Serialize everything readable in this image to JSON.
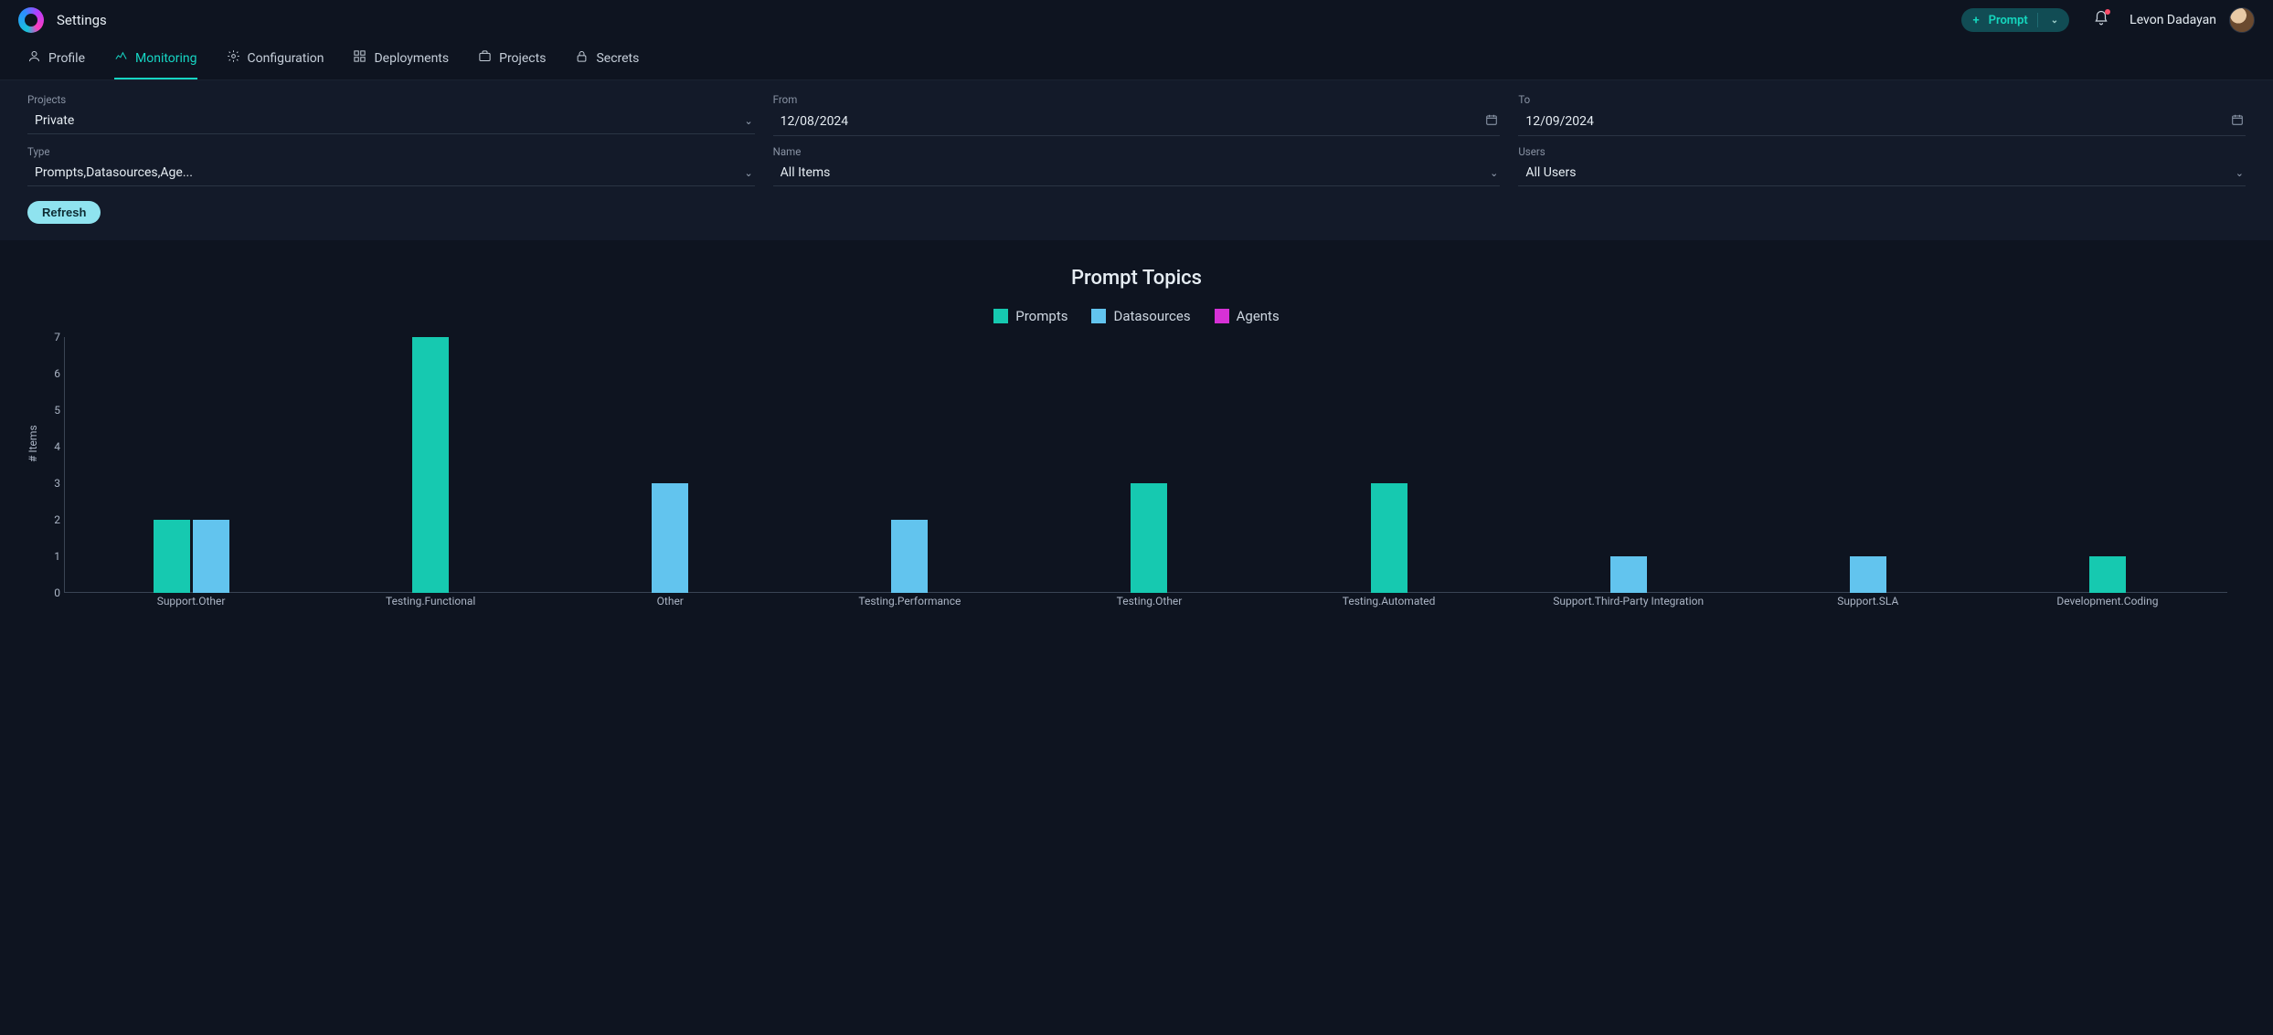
{
  "header": {
    "app_title": "Settings",
    "prompt_button_label": "Prompt",
    "user_name": "Levon Dadayan"
  },
  "tabs": [
    {
      "id": "profile",
      "label": "Profile",
      "icon": "person",
      "active": false
    },
    {
      "id": "monitoring",
      "label": "Monitoring",
      "icon": "monitoring",
      "active": true
    },
    {
      "id": "configuration",
      "label": "Configuration",
      "icon": "gear",
      "active": false
    },
    {
      "id": "deployments",
      "label": "Deployments",
      "icon": "grid",
      "active": false
    },
    {
      "id": "projects",
      "label": "Projects",
      "icon": "briefcase",
      "active": false
    },
    {
      "id": "secrets",
      "label": "Secrets",
      "icon": "lock",
      "active": false
    }
  ],
  "filters": {
    "projects": {
      "label": "Projects",
      "value": "Private"
    },
    "from": {
      "label": "From",
      "value": "12/08/2024"
    },
    "to": {
      "label": "To",
      "value": "12/09/2024"
    },
    "type": {
      "label": "Type",
      "value": "Prompts,Datasources,Age..."
    },
    "name": {
      "label": "Name",
      "value": "All Items"
    },
    "users": {
      "label": "Users",
      "value": "All Users"
    },
    "refresh": "Refresh"
  },
  "chart_data": {
    "type": "bar",
    "title": "Prompt Topics",
    "ylabel": "# Items",
    "xlabel": "",
    "ylim": [
      0,
      7
    ],
    "yticks": [
      0,
      1,
      2,
      3,
      4,
      5,
      6,
      7
    ],
    "categories": [
      "Support.Other",
      "Testing.Functional",
      "Other",
      "Testing.Performance",
      "Testing.Other",
      "Testing.Automated",
      "Support.Third-Party Integration",
      "Support.SLA",
      "Development.Coding"
    ],
    "series": [
      {
        "name": "Prompts",
        "color": "#16c9b0",
        "values": [
          2,
          7,
          0,
          0,
          3,
          3,
          0,
          0,
          1
        ]
      },
      {
        "name": "Datasources",
        "color": "#62c4ee",
        "values": [
          2,
          0,
          3,
          2,
          0,
          0,
          1,
          1,
          0
        ]
      },
      {
        "name": "Agents",
        "color": "#d631d6",
        "values": [
          0,
          0,
          0,
          0,
          0,
          0,
          0,
          0,
          0
        ]
      }
    ]
  }
}
